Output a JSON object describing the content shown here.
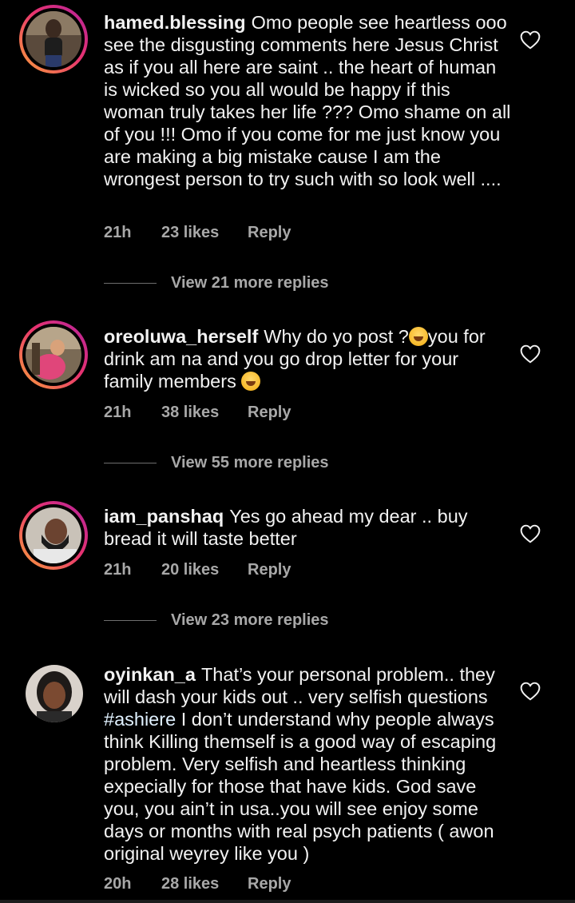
{
  "comments": [
    {
      "username": "hamed.blessing",
      "text": "Omo people see heartless ooo see the disgusting comments here Jesus Christ as if you all here are saint .. the heart of human is wicked so you all would be happy if this woman truly takes her life ??? Omo shame on all of you !!! Omo if you come for me just know you are making a big mistake cause I am the wrongest person to try such with so look well ....",
      "time": "21h",
      "likes": "23 likes",
      "reply_label": "Reply",
      "view_replies": "View 21 more replies"
    },
    {
      "username": "oreoluwa_herself",
      "text_part1": "Why do yo post ?",
      "text_part2": "you for drink am na and you go drop letter for your family members",
      "time": "21h",
      "likes": "38 likes",
      "reply_label": "Reply",
      "view_replies": "View 55 more replies"
    },
    {
      "username": "iam_panshaq",
      "text": "Yes go ahead my dear .. buy bread it will taste better",
      "time": "21h",
      "likes": "20 likes",
      "reply_label": "Reply",
      "view_replies": "View 23 more replies"
    },
    {
      "username": "oyinkan_a",
      "text_part1": "That’s your personal problem.. they will dash your kids out .. very selfish questions",
      "hashtag": "#ashiere",
      "text_part2": "I don’t understand why people always think Killing themself is a good way of escaping problem. Very selfish and heartless thinking expecially for those that have kids. God save you, you ain’t in usa..you will see enjoy some days or months with real psych patients ( awon original weyrey like you )",
      "time": "20h",
      "likes": "28 likes",
      "reply_label": "Reply"
    }
  ],
  "colors": {
    "background": "#000000",
    "text": "#f2f2f2",
    "meta": "#a8a8a8",
    "hashtag": "#e0f1ff",
    "story_ring_start": "#f9a13a",
    "story_ring_end": "#b3229d"
  },
  "icons": {
    "like": "heart-outline-icon",
    "emoji_laugh": "tears-of-joy-emoji",
    "emoji_rofl": "rolling-laughing-emoji"
  }
}
